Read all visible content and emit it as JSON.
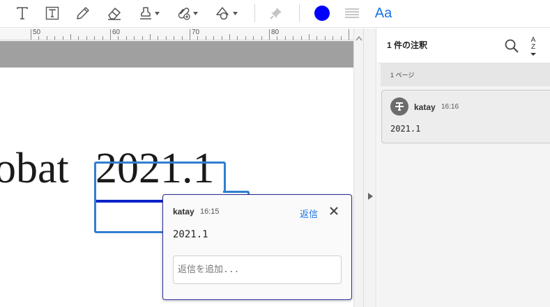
{
  "toolbar": {
    "tools": [
      {
        "icon": "text-icon",
        "has_menu": false
      },
      {
        "icon": "text-box-icon",
        "has_menu": false
      },
      {
        "icon": "pencil-icon",
        "has_menu": false
      },
      {
        "icon": "eraser-icon",
        "has_menu": false
      },
      {
        "icon": "stamp-icon",
        "has_menu": true
      },
      {
        "icon": "attach-icon",
        "has_menu": true
      },
      {
        "icon": "shapes-icon",
        "has_menu": true
      },
      {
        "icon": "pin-icon",
        "has_menu": false
      }
    ],
    "color": "#0000ff",
    "font_button_label": "Aa"
  },
  "ruler": {
    "labels": [
      "50",
      "60",
      "70",
      "80"
    ]
  },
  "document": {
    "text_before": "obat",
    "text_struck": "2021.1",
    "strike_color": "#0a22c8"
  },
  "popup": {
    "author": "katay",
    "time": "16:15",
    "reply_label": "返信",
    "body": "2021.1",
    "reply_placeholder": "返信を追加..."
  },
  "panel": {
    "title": "1 件の注釈",
    "page_group": "1 ページ",
    "sort_label_top": "A",
    "sort_label_bottom": "Z",
    "comments": [
      {
        "author": "katay",
        "time": "16:16",
        "body": "2021.1"
      }
    ]
  }
}
